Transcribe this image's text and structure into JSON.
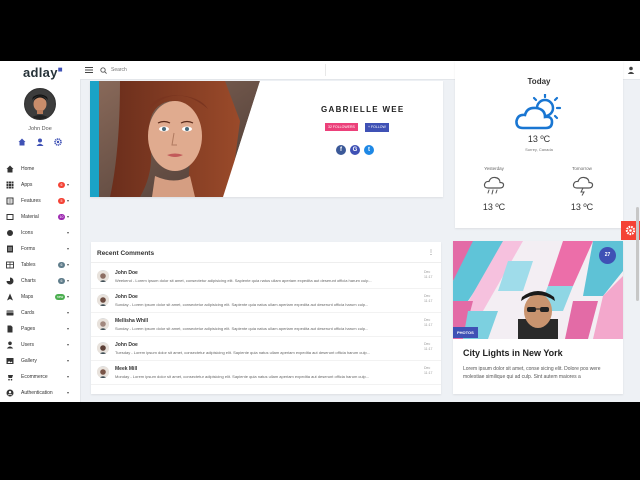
{
  "brand": {
    "name": "adlay"
  },
  "user": {
    "name": "John Doe"
  },
  "sidebar": {
    "items": [
      {
        "label": "Home",
        "icon": "home-icon"
      },
      {
        "label": "Apps",
        "icon": "apps-icon",
        "badge": "6",
        "badge_color": "#f44336"
      },
      {
        "label": "Features",
        "icon": "features-icon",
        "badge": "5",
        "badge_color": "#f44336"
      },
      {
        "label": "Material",
        "icon": "material-icon",
        "badge": "10",
        "badge_color": "#9c27b0"
      },
      {
        "label": "Icons",
        "icon": "icons-icon"
      },
      {
        "label": "Forms",
        "icon": "forms-icon"
      },
      {
        "label": "Tables",
        "icon": "tables-icon",
        "badge": "6",
        "badge_color": "#607d8b"
      },
      {
        "label": "Charts",
        "icon": "charts-icon",
        "badge": "6",
        "badge_color": "#607d8b"
      },
      {
        "label": "Maps",
        "icon": "maps-icon",
        "badge": "new",
        "badge_color": "#4caf50"
      },
      {
        "label": "Cards",
        "icon": "cards-icon"
      },
      {
        "label": "Pages",
        "icon": "pages-icon"
      },
      {
        "label": "Users",
        "icon": "users-icon"
      },
      {
        "label": "Gallery",
        "icon": "gallery-icon"
      },
      {
        "label": "Ecommerce",
        "icon": "ecommerce-icon"
      },
      {
        "label": "Authentication",
        "icon": "auth-icon"
      }
    ]
  },
  "topbar": {
    "search_placeholder": "Search"
  },
  "profile": {
    "name": "GABRIELLE WEE",
    "button1": "32 FOLLOWERS",
    "button2": "+ FOLLOW"
  },
  "weather": {
    "today": "Today",
    "temp": "13 ºC",
    "location": "Surrey, Canada",
    "yesterday_label": "Yesterday",
    "yesterday_temp": "13 ºC",
    "tomorrow_label": "Tomorrow",
    "tomorrow_temp": "13 ºC"
  },
  "comments": {
    "title": "Recent Comments",
    "items": [
      {
        "name": "John Doe",
        "text": "Weekend - Lorem ipsum dolor sit amet, consectetur adipisicing elit. Sapiente quia natus ullam aperiam expedita aut deserunt officia harum culp...",
        "time": "Dec 11:17"
      },
      {
        "name": "John Doe",
        "text": "Sunday - Lorem ipsum dolor sit amet, consectetur adipisicing elit. Sapiente quia natus ullam aperiam expedita aut deserunt officia harum culp...",
        "time": "Dec 11:17"
      },
      {
        "name": "Mellisha Whill",
        "text": "Sunday - Lorem ipsum dolor sit amet, consectetur adipisicing elit. Sapiente quia natus ullam aperiam expedita aut deserunt officia harum culp...",
        "time": "Dec 11:17"
      },
      {
        "name": "John Doe",
        "text": "Tuesday - Lorem ipsum dolor sit amet, consectetur adipisicing elit. Sapiente quia natus ullam aperiam expedita aut deserunt officia harum culp...",
        "time": "Dec 11:17"
      },
      {
        "name": "Meek Mill",
        "text": "Monday - Lorem ipsum dolor sit amet, consectetur adipisicing elit. Sapiente quia natus ullam aperiam expedita aut deserunt officia harum culp...",
        "time": "Dec 11:17"
      }
    ]
  },
  "photo": {
    "badge": "27",
    "tag": "PHOTOS",
    "title": "City Lights in New York",
    "desc": "Lorem ipsum dolor sit amet, conse sicing elit. Dolore pos were molestiae similique qui ad culp. Sint autem maiores a"
  },
  "colors": {
    "primary": "#3f51b5",
    "accent": "#ec407a",
    "danger": "#f44336",
    "weather_icon": "#1976d2"
  }
}
